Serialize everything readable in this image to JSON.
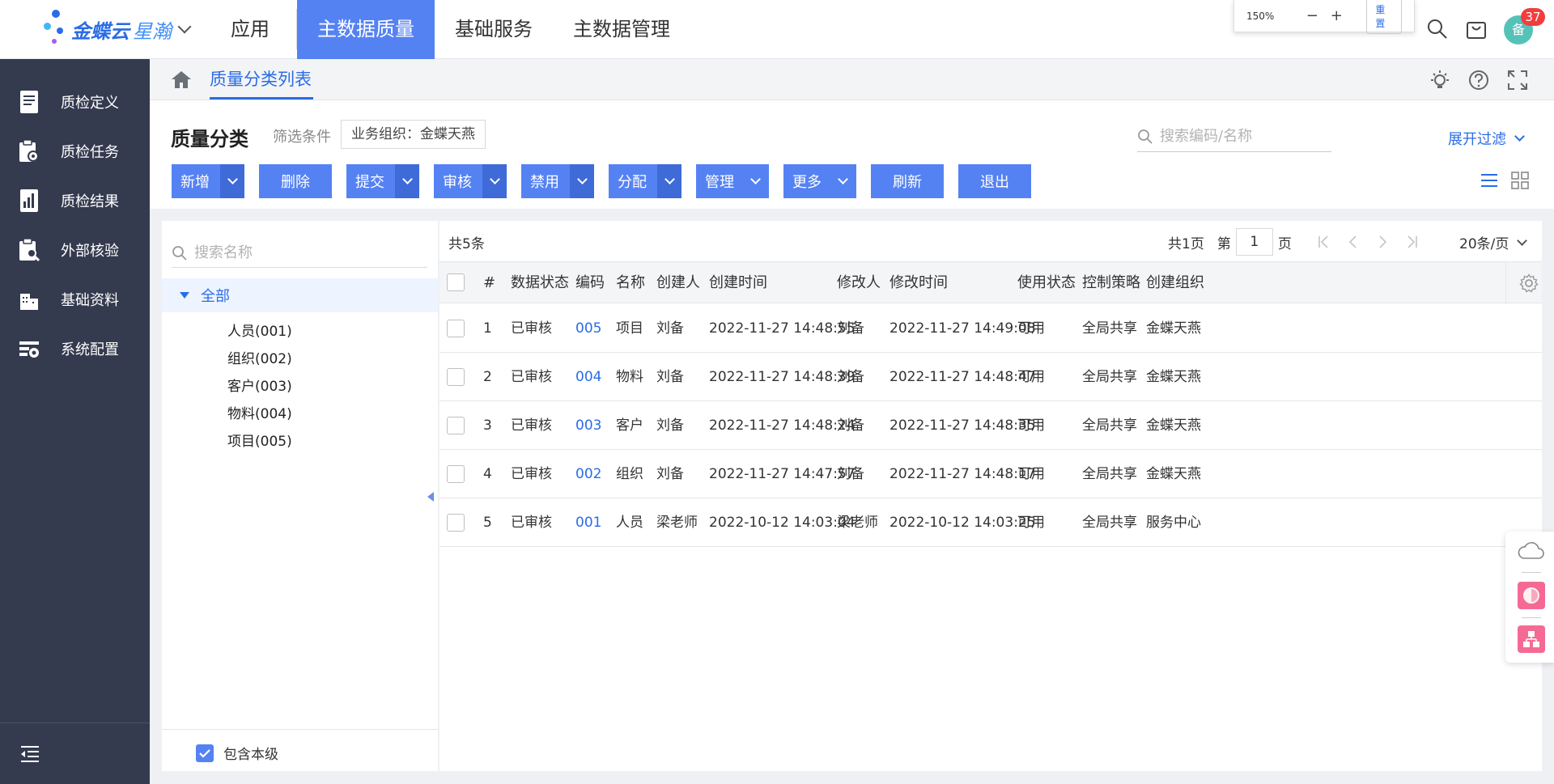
{
  "colors": {
    "primary": "#5582f3",
    "primary_dark": "#3e6bd8",
    "link": "#2a6ce6",
    "sidebar": "#343b4f"
  },
  "app": {
    "logo_main": "金蝶云",
    "logo_sub": "星瀚"
  },
  "nav": [
    "应用",
    "主数据质量",
    "基础服务",
    "主数据管理"
  ],
  "zoom": {
    "level": "150%",
    "minus": "−",
    "plus": "+",
    "reset": "重置"
  },
  "user": {
    "avatar_text": "备",
    "badge_count": "37"
  },
  "sidebar": {
    "items": [
      {
        "label": "质检定义",
        "icon": "book-icon"
      },
      {
        "label": "质检任务",
        "icon": "clipboard-gear-icon"
      },
      {
        "label": "质检结果",
        "icon": "report-icon"
      },
      {
        "label": "外部核验",
        "icon": "clipboard-search-icon"
      },
      {
        "label": "基础资料",
        "icon": "building-icon"
      },
      {
        "label": "系统配置",
        "icon": "settings-panel-icon"
      }
    ]
  },
  "breadcrumb": {
    "tab": "质量分类列表"
  },
  "header": {
    "title": "质量分类",
    "filter_label": "筛选条件",
    "filter_chip": "业务组织：金蝶天燕",
    "search_placeholder": "搜索编码/名称",
    "expand_filter": "展开过滤"
  },
  "toolbar": {
    "add": "新增",
    "delete": "删除",
    "submit": "提交",
    "audit": "审核",
    "disable": "禁用",
    "assign": "分配",
    "manage": "管理",
    "more": "更多",
    "refresh": "刷新",
    "exit": "退出"
  },
  "tree": {
    "search_placeholder": "搜索名称",
    "root": "全部",
    "nodes": [
      "人员(001)",
      "组织(002)",
      "客户(003)",
      "物料(004)",
      "项目(005)"
    ],
    "include_level": "包含本级"
  },
  "table": {
    "total": "共5条",
    "pager": {
      "pages": "共1页",
      "page_prefix": "第",
      "page": "1",
      "page_suffix": "页",
      "page_size": "20条/页"
    },
    "columns": [
      "#",
      "数据状态",
      "编码",
      "名称",
      "创建人",
      "创建时间",
      "修改人",
      "修改时间",
      "使用状态",
      "控制策略",
      "创建组织"
    ],
    "rows": [
      [
        "1",
        "已审核",
        "005",
        "项目",
        "刘备",
        "2022-11-27 14:48:55",
        "刘备",
        "2022-11-27 14:49:08",
        "可用",
        "全局共享",
        "金蝶天燕"
      ],
      [
        "2",
        "已审核",
        "004",
        "物料",
        "刘备",
        "2022-11-27 14:48:39",
        "刘备",
        "2022-11-27 14:48:47",
        "可用",
        "全局共享",
        "金蝶天燕"
      ],
      [
        "3",
        "已审核",
        "003",
        "客户",
        "刘备",
        "2022-11-27 14:48:24",
        "刘备",
        "2022-11-27 14:48:35",
        "可用",
        "全局共享",
        "金蝶天燕"
      ],
      [
        "4",
        "已审核",
        "002",
        "组织",
        "刘备",
        "2022-11-27 14:47:57",
        "刘备",
        "2022-11-27 14:48:17",
        "可用",
        "全局共享",
        "金蝶天燕"
      ],
      [
        "5",
        "已审核",
        "001",
        "人员",
        "梁老师",
        "2022-10-12 14:03:04",
        "梁老师",
        "2022-10-12 14:03:25",
        "可用",
        "全局共享",
        "服务中心"
      ]
    ]
  }
}
